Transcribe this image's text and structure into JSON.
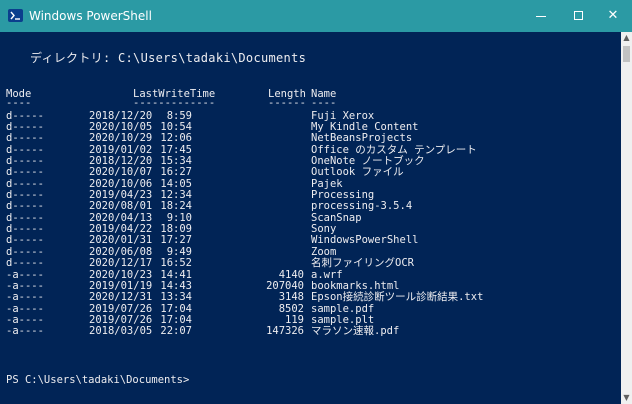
{
  "window": {
    "title": "Windows PowerShell",
    "icon": "powershell-icon",
    "buttons": [
      "minimize-icon",
      "maximize-icon",
      "close-icon"
    ]
  },
  "console": {
    "directory_line": "ディレクトリ: C:\\Users\\tadaki\\Documents",
    "headers": {
      "mode": "Mode",
      "time": "LastWriteTime",
      "length": "Length",
      "name": "Name"
    },
    "separators": {
      "mode": "----",
      "time": "-------------",
      "length": "------",
      "name": "----"
    },
    "rows": [
      {
        "mode": "d-----",
        "date": "2018/12/20",
        "time": "8:59",
        "length": "",
        "name": "Fuji Xerox"
      },
      {
        "mode": "d-----",
        "date": "2020/10/05",
        "time": "10:54",
        "length": "",
        "name": "My Kindle Content"
      },
      {
        "mode": "d-----",
        "date": "2020/10/29",
        "time": "12:06",
        "length": "",
        "name": "NetBeansProjects"
      },
      {
        "mode": "d-----",
        "date": "2019/01/02",
        "time": "17:45",
        "length": "",
        "name": "Office のカスタム テンプレート"
      },
      {
        "mode": "d-----",
        "date": "2018/12/20",
        "time": "15:34",
        "length": "",
        "name": "OneNote ノートブック"
      },
      {
        "mode": "d-----",
        "date": "2020/10/07",
        "time": "16:27",
        "length": "",
        "name": "Outlook ファイル"
      },
      {
        "mode": "d-----",
        "date": "2020/10/06",
        "time": "14:05",
        "length": "",
        "name": "Pajek"
      },
      {
        "mode": "d-----",
        "date": "2019/04/23",
        "time": "12:34",
        "length": "",
        "name": "Processing"
      },
      {
        "mode": "d-----",
        "date": "2020/08/01",
        "time": "18:24",
        "length": "",
        "name": "processing-3.5.4"
      },
      {
        "mode": "d-----",
        "date": "2020/04/13",
        "time": "9:10",
        "length": "",
        "name": "ScanSnap"
      },
      {
        "mode": "d-----",
        "date": "2019/04/22",
        "time": "18:09",
        "length": "",
        "name": "Sony"
      },
      {
        "mode": "d-----",
        "date": "2020/01/31",
        "time": "17:27",
        "length": "",
        "name": "WindowsPowerShell"
      },
      {
        "mode": "d-----",
        "date": "2020/06/08",
        "time": "9:49",
        "length": "",
        "name": "Zoom"
      },
      {
        "mode": "d-----",
        "date": "2020/12/17",
        "time": "16:52",
        "length": "",
        "name": "名刺ファイリングOCR"
      },
      {
        "mode": "-a----",
        "date": "2020/10/23",
        "time": "14:41",
        "length": "4140",
        "name": "a.wrf"
      },
      {
        "mode": "-a----",
        "date": "2019/01/19",
        "time": "14:43",
        "length": "207040",
        "name": "bookmarks.html"
      },
      {
        "mode": "-a----",
        "date": "2020/12/31",
        "time": "13:34",
        "length": "3148",
        "name": "Epson接続診断ツール診断結果.txt"
      },
      {
        "mode": "-a----",
        "date": "2019/07/26",
        "time": "17:04",
        "length": "8502",
        "name": "sample.pdf"
      },
      {
        "mode": "-a----",
        "date": "2019/07/26",
        "time": "17:04",
        "length": "119",
        "name": "sample.plt"
      },
      {
        "mode": "-a----",
        "date": "2018/03/05",
        "time": "22:07",
        "length": "147326",
        "name": "マラソン速報.pdf"
      }
    ],
    "prompt": "PS C:\\Users\\tadaki\\Documents>"
  },
  "colors": {
    "titlebar": "#2b9aa4",
    "console_background": "#012456",
    "console_text": "#eeedf0"
  }
}
